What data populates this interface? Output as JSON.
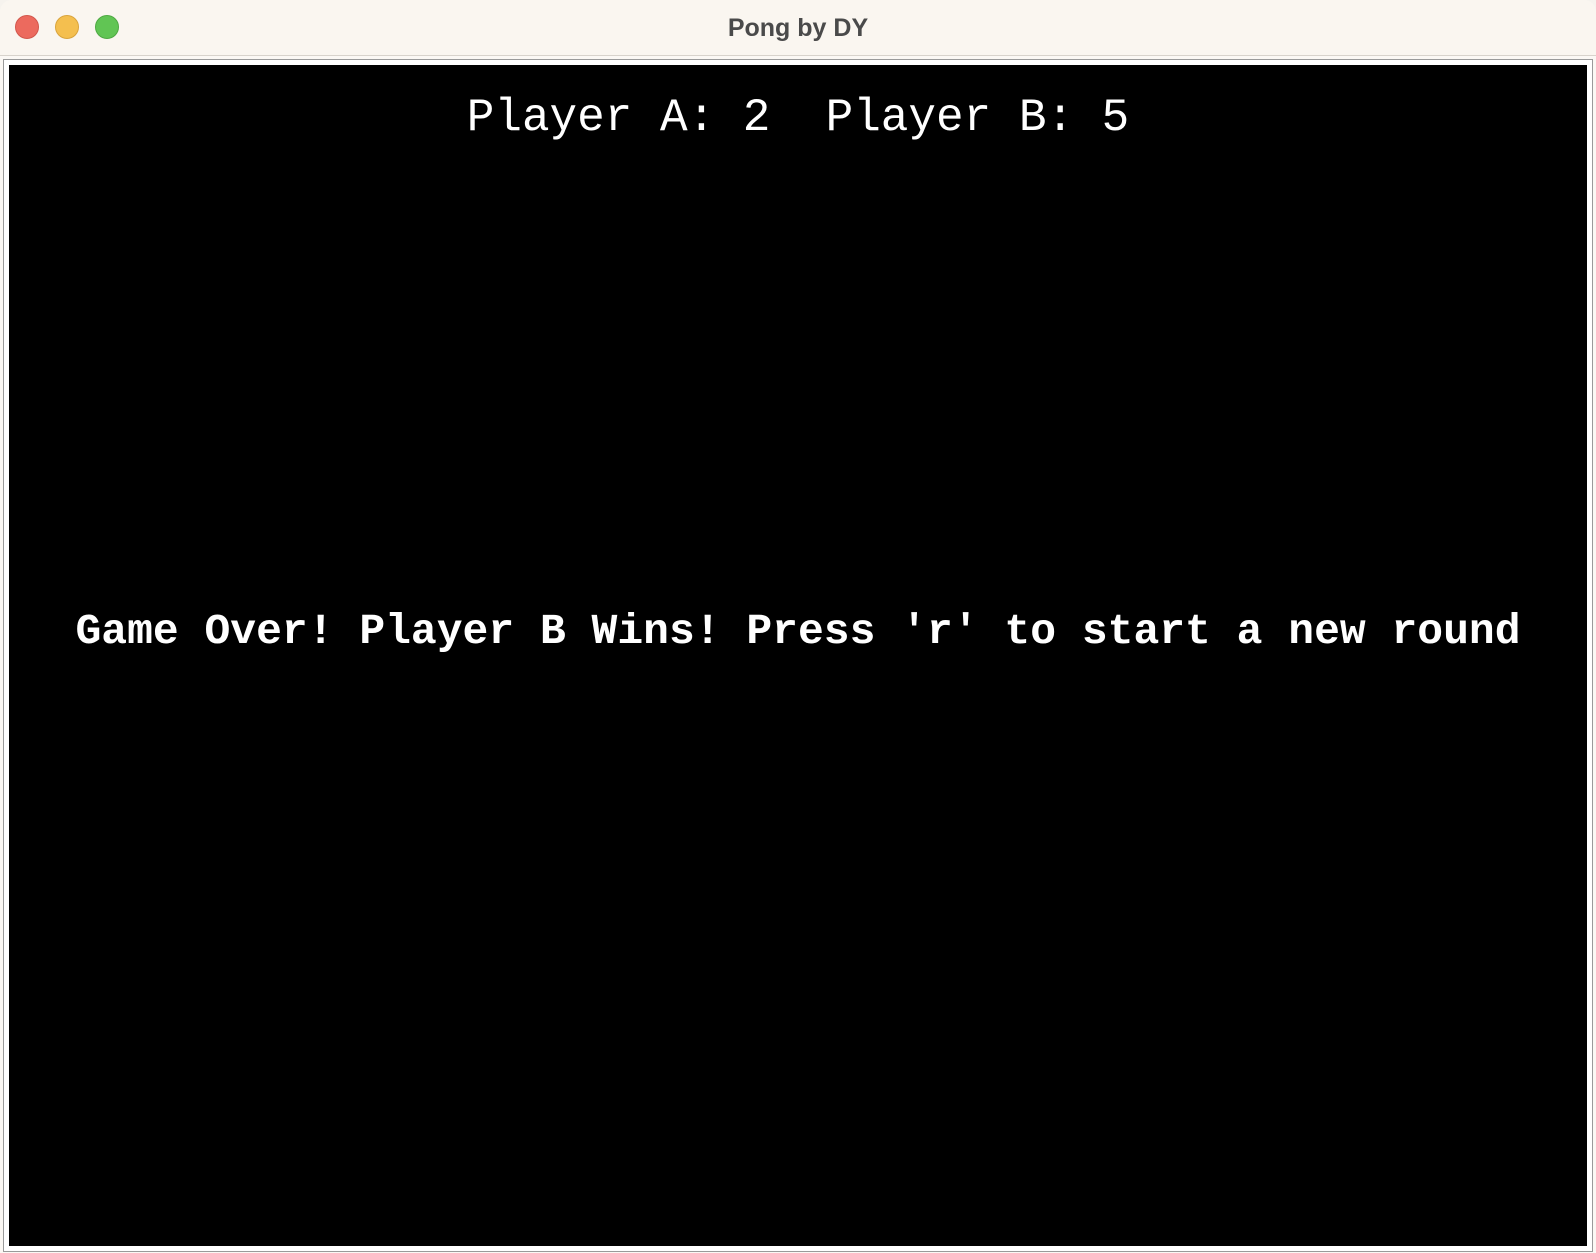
{
  "window": {
    "title": "Pong by DY"
  },
  "scoreboard": {
    "text": "Player A: 2  Player B: 5"
  },
  "game": {
    "message": "Game Over! Player B Wins! Press 'r' to start a new round"
  },
  "colors": {
    "canvas_background": "#000000",
    "text": "#ffffff",
    "close_button": "#ec6a5e",
    "minimize_button": "#f4bf4f",
    "zoom_button": "#61c554"
  }
}
